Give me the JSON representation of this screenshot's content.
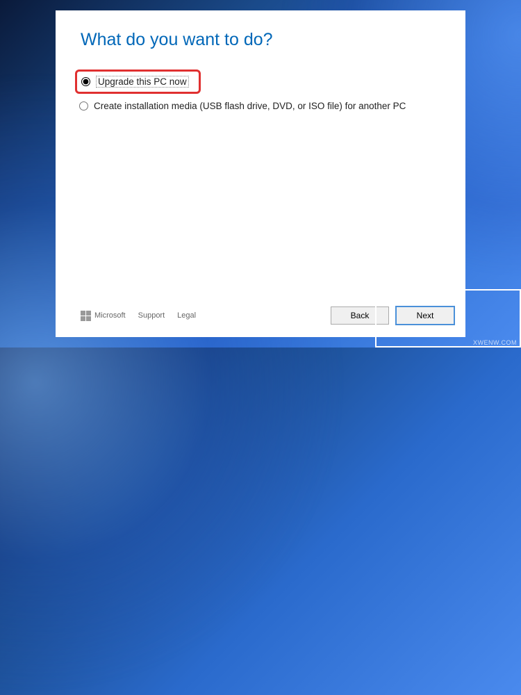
{
  "heading": "What do you want to do?",
  "options": {
    "upgrade": "Upgrade this PC now",
    "media": "Create installation media (USB flash drive, DVD, or ISO file) for another PC"
  },
  "footer": {
    "brand": "Microsoft",
    "support": "Support",
    "legal": "Legal"
  },
  "buttons": {
    "back": "Back",
    "next": "Next"
  },
  "watermark": "XWENW.COM"
}
